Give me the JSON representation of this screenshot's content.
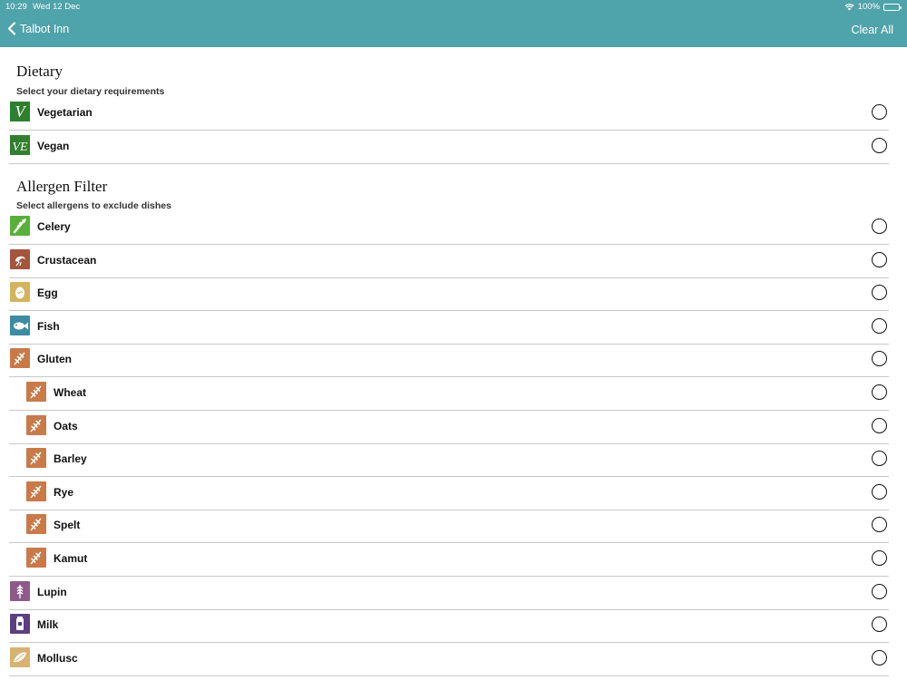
{
  "status": {
    "time": "10:29",
    "date": "Wed 12 Dec",
    "battery": "100%"
  },
  "nav": {
    "back_label": "Talbot Inn",
    "clear_all": "Clear All"
  },
  "dietary": {
    "title": "Dietary",
    "subtitle": "Select your dietary requirements",
    "items": [
      {
        "label": "Vegetarian",
        "icon": "vegetarian-icon",
        "glyph": "V"
      },
      {
        "label": "Vegan",
        "icon": "vegan-icon",
        "glyph": "VE"
      }
    ]
  },
  "allergens": {
    "title": "Allergen Filter",
    "subtitle": "Select allergens to exclude dishes",
    "items": [
      {
        "label": "Celery",
        "icon": "celery-icon",
        "color": "#5aaf3c"
      },
      {
        "label": "Crustacean",
        "icon": "crustacean-icon",
        "color": "#a3553d"
      },
      {
        "label": "Egg",
        "icon": "egg-icon",
        "color": "#d4b35f"
      },
      {
        "label": "Fish",
        "icon": "fish-icon",
        "color": "#3f8aa3"
      },
      {
        "label": "Gluten",
        "icon": "gluten-icon",
        "color": "#c87a4b"
      },
      {
        "label": "Wheat",
        "icon": "wheat-icon",
        "color": "#c87a4b",
        "sub": true
      },
      {
        "label": "Oats",
        "icon": "oats-icon",
        "color": "#c87a4b",
        "sub": true
      },
      {
        "label": "Barley",
        "icon": "barley-icon",
        "color": "#c87a4b",
        "sub": true
      },
      {
        "label": "Rye",
        "icon": "rye-icon",
        "color": "#c87a4b",
        "sub": true
      },
      {
        "label": "Spelt",
        "icon": "spelt-icon",
        "color": "#c87a4b",
        "sub": true
      },
      {
        "label": "Kamut",
        "icon": "kamut-icon",
        "color": "#c87a4b",
        "sub": true
      },
      {
        "label": "Lupin",
        "icon": "lupin-icon",
        "color": "#8e5a8a"
      },
      {
        "label": "Milk",
        "icon": "milk-icon",
        "color": "#5d3f80"
      },
      {
        "label": "Mollusc",
        "icon": "mollusc-icon",
        "color": "#d8b274"
      }
    ]
  },
  "colors": {
    "header": "#4fa3aa",
    "dietary_green": "#2f7f2f"
  }
}
